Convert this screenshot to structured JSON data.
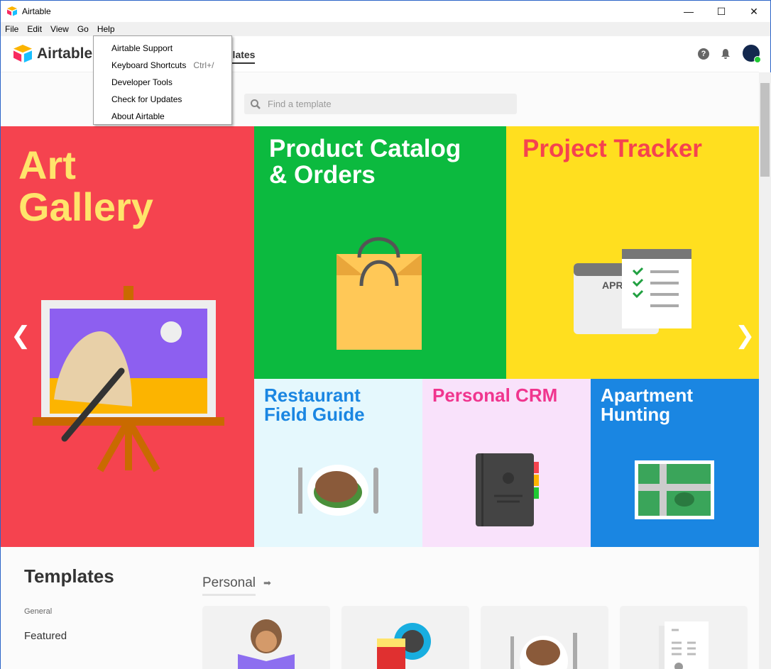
{
  "window": {
    "title": "Airtable",
    "minimize": "—",
    "maximize": "☐",
    "close": "✕"
  },
  "menubar": [
    "File",
    "Edit",
    "View",
    "Go",
    "Help"
  ],
  "help_menu": [
    {
      "label": "Airtable Support"
    },
    {
      "label": "Keyboard Shortcuts",
      "shortcut": "Ctrl+/"
    },
    {
      "label": "Developer Tools"
    },
    {
      "label": "Check for Updates"
    },
    {
      "label": "About Airtable"
    }
  ],
  "header": {
    "logo": "Airtable",
    "active_tab": "Templates",
    "active_tab_visible": "plates"
  },
  "search": {
    "placeholder": "Find a template"
  },
  "hero": {
    "tiles": [
      {
        "title": "Art Gallery",
        "color": "#f5434f",
        "text_color": "#ffe46b"
      },
      {
        "title": "Product Catalog & Orders",
        "color": "#0cba3f",
        "text_color": "#ffffff"
      },
      {
        "title": "Project Tracker",
        "color": "#ffdf1f",
        "text_color": "#f5434f"
      },
      {
        "title": "Restaurant Field Guide",
        "color": "#e5f8fd",
        "text_color": "#1a86e2"
      },
      {
        "title": "Personal CRM",
        "color": "#f9e2fb",
        "text_color": "#f0358e"
      },
      {
        "title": "Apartment Hunting",
        "color": "#1a86e2",
        "text_color": "#ffffff"
      }
    ],
    "calendar_label": "APR"
  },
  "templates": {
    "title": "Templates",
    "section_label": "General",
    "nav_featured": "Featured",
    "category": "Personal"
  }
}
